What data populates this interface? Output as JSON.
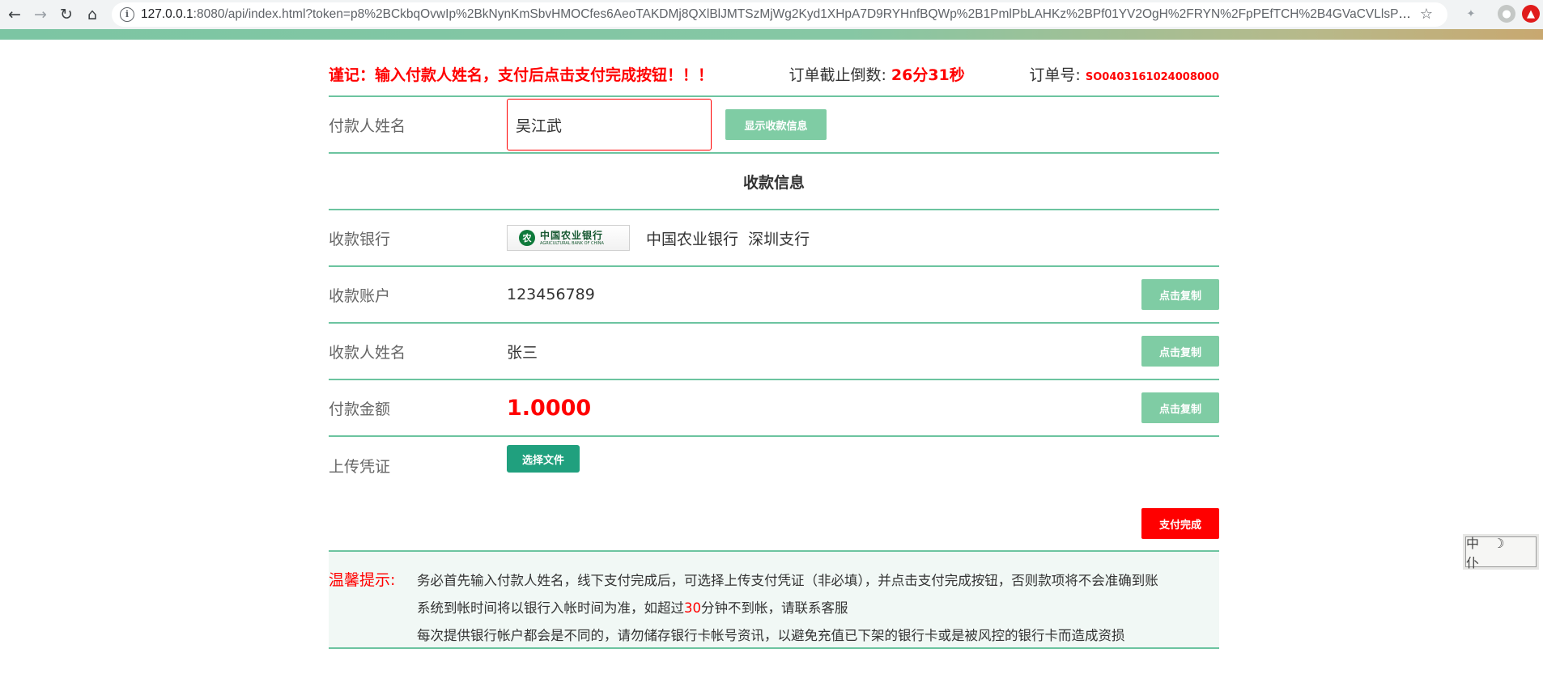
{
  "browser": {
    "url_host": "127.0.0.1",
    "url_rest": ":8080/api/index.html?token=p8%2BCkbqOvwIp%2BkNynKmSbvHMOCfes6AeoTAKDMj8QXlBlJMTSzMjWg2Kyd1XHpA7D9RYHnfBQWp%2B1PmlPbLAHKz%2BPf01YV2OgH%2FRYN%2FpPEfTCH%2B4GVaCVLlsPmdw1liFMk%2F..."
  },
  "header": {
    "notice": "谨记：输入付款人姓名，支付后点击支付完成按钮！！！",
    "countdown_label": "订单截止倒数: ",
    "countdown_value": "26分31秒",
    "order_label": "订单号: ",
    "order_value": "SO0403161024008000"
  },
  "payer": {
    "label": "付款人姓名",
    "value": "吴江武",
    "show_button": "显示收款信息"
  },
  "section_title": "收款信息",
  "bank": {
    "label": "收款银行",
    "logo_cn": "中国农业银行",
    "logo_en": "AGRICULTURAL BANK OF CHINA",
    "name": "中国农业银行  深圳支行"
  },
  "account": {
    "label": "收款账户",
    "value": "123456789",
    "copy": "点击复制"
  },
  "payee": {
    "label": "收款人姓名",
    "value": "张三",
    "copy": "点击复制"
  },
  "amount": {
    "label": "付款金额",
    "value": "1.0000",
    "copy": "点击复制"
  },
  "upload": {
    "label": "上传凭证",
    "button": "选择文件"
  },
  "done_button": "支付完成",
  "tips": {
    "label": "温馨提示:",
    "line1": "务必首先输入付款人姓名，线下支付完成后，可选择上传支付凭证（非必填），并点击支付完成按钮，否则款项将不会准确到账",
    "line2_a": "系统到帐时间将以银行入帐时间为准，如超过",
    "line2_b": "30",
    "line2_c": "分钟不到帐，请联系客服",
    "line3": "每次提供银行帐户都会是不同的，请勿储存银行卡帐号资讯，以避免充值已下架的银行卡或是被风控的银行卡而造成资损"
  },
  "side_widget": "中 ☽ 仆"
}
